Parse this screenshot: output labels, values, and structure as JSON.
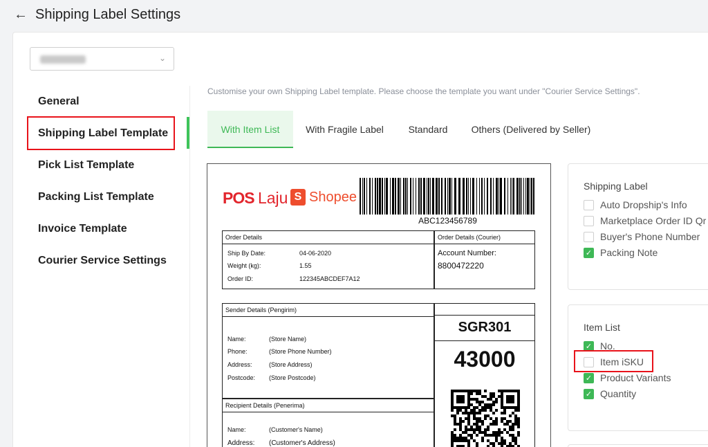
{
  "header": {
    "title": "Shipping Label Settings",
    "back_icon": "arrow-left-icon"
  },
  "store_select": {
    "selected": "",
    "icon": "chevron-down-icon"
  },
  "sidebar": {
    "items": [
      {
        "label": "General",
        "active": false
      },
      {
        "label": "Shipping Label Template",
        "active": true
      },
      {
        "label": "Pick List Template",
        "active": false
      },
      {
        "label": "Packing List Template",
        "active": false
      },
      {
        "label": "Invoice Template",
        "active": false
      },
      {
        "label": "Courier Service Settings",
        "active": false
      }
    ]
  },
  "hint": "Customise your own Shipping Label template. Please choose the template you want under \"Courier Service Settings\".",
  "tabs": [
    {
      "label": "With Item List",
      "active": true
    },
    {
      "label": "With Fragile Label",
      "active": false
    },
    {
      "label": "Standard",
      "active": false
    },
    {
      "label": "Others (Delivered by Seller)",
      "active": false
    }
  ],
  "preview": {
    "logo_pos": "POS",
    "logo_laju": "Laju",
    "logo_shopee": "Shopee",
    "shopee_icon_letter": "S",
    "barcode_number": "ABC123456789",
    "order_details": {
      "header": "Order Details",
      "ship_by_label": "Ship By Date:",
      "ship_by_value": "04-06-2020",
      "weight_label": "Weight (kg):",
      "weight_value": "1.55",
      "order_id_label": "Order ID:",
      "order_id_value": "122345ABCDEF7A12"
    },
    "courier_details": {
      "header": "Order Details (Courier)",
      "account_label": "Account Number:",
      "account_value": "8800472220"
    },
    "sender": {
      "header": "Sender Details (Pengirim)",
      "name_label": "Name:",
      "name_value": "(Store Name)",
      "phone_label": "Phone:",
      "phone_value": "(Store Phone Number)",
      "address_label": "Address:",
      "address_value": "(Store Address)",
      "postcode_label": "Postcode:",
      "postcode_value": "(Store Postcode)"
    },
    "recipient": {
      "header": "Recipient Details (Penerima)",
      "name_label": "Name:",
      "name_value": "(Customer's Name)",
      "address_label": "Address:",
      "address_value": "(Customer's Address)"
    },
    "route_code": "SGR301",
    "postcode_big": "43000"
  },
  "shipping_label_card": {
    "title": "Shipping Label",
    "options": [
      {
        "label": "Auto Dropship's Info",
        "checked": false
      },
      {
        "label": "Marketplace Order ID Qr",
        "checked": false
      },
      {
        "label": "Buyer's Phone Number",
        "checked": false
      },
      {
        "label": "Packing Note",
        "checked": true
      }
    ]
  },
  "item_list_card": {
    "title": "Item List",
    "options": [
      {
        "label": "No.",
        "checked": true
      },
      {
        "label": "Item iSKU",
        "checked": false
      },
      {
        "label": "Product Variants",
        "checked": true
      },
      {
        "label": "Quantity",
        "checked": true
      }
    ]
  },
  "colors": {
    "accent_green": "#3eb856",
    "highlight_red": "#e8121a",
    "pos_red": "#e2252c",
    "shopee_orange": "#ee4d2d"
  }
}
